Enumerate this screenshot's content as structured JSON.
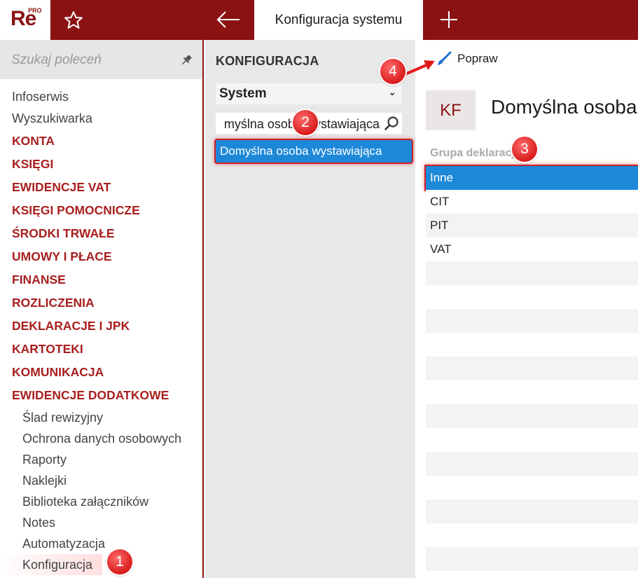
{
  "app": {
    "logo_text": "Re",
    "logo_badge": "PRO",
    "active_tab": "Konfiguracja systemu"
  },
  "sidebar": {
    "search_placeholder": "Szukaj poleceń",
    "top_items": [
      "Infoserwis",
      "Wyszukiwarka"
    ],
    "sections": [
      "KONTA",
      "KSIĘGI",
      "EWIDENCJE VAT",
      "KSIĘGI POMOCNICZE",
      "ŚRODKI TRWAŁE",
      "UMOWY I PŁACE",
      "FINANSE",
      "ROZLICZENIA",
      "DEKLARACJE I JPK",
      "KARTOTEKI",
      "KOMUNIKACJA",
      "EWIDENCJE DODATKOWE"
    ],
    "sub_items": [
      "Ślad rewizyjny",
      "Ochrona danych osobowych",
      "Raporty",
      "Naklejki",
      "Biblioteka załączników",
      "Notes",
      "Automatyzacja",
      "Konfiguracja"
    ]
  },
  "middle": {
    "title": "KONFIGURACJA",
    "select_value": "System",
    "filter_value": "Domyślna osoba wystawiająca",
    "filter_visible": "myślna osoba wystawiająca",
    "result": "Domyślna osoba wystawiająca"
  },
  "right": {
    "toolbar_edit": "Popraw",
    "badge": "KF",
    "heading": "Domyślna osoba",
    "column_header": "Grupa deklaracji",
    "rows": [
      "Inne",
      "CIT",
      "PIT",
      "VAT"
    ],
    "selected_row": "Inne"
  },
  "markers": [
    "1",
    "2",
    "3",
    "4"
  ],
  "colors": {
    "brand": "#8b1212",
    "section_text": "#a81f1f",
    "selection": "#1e88d8",
    "marker": "#d91c1c"
  }
}
